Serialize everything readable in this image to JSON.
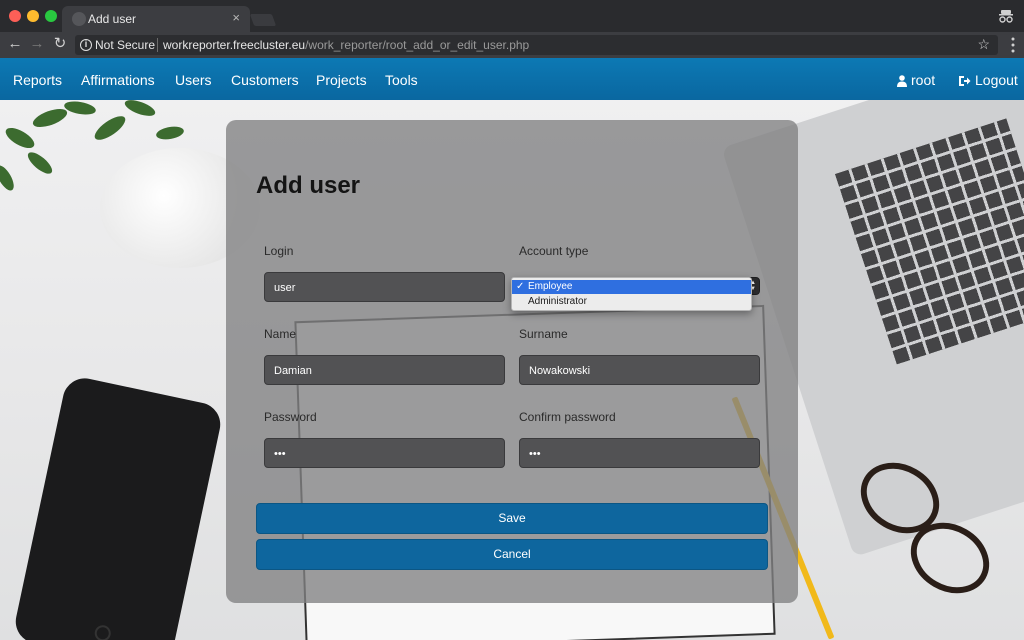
{
  "browser": {
    "tab_title": "Add user",
    "tab_close": "×",
    "security_label": "Not Secure",
    "url_host": "workreporter.freecluster.eu",
    "url_path": "/work_reporter/root_add_or_edit_user.php"
  },
  "navbar": {
    "items": [
      "Reports",
      "Affirmations",
      "Users",
      "Customers",
      "Projects",
      "Tools"
    ],
    "user_label": "root",
    "logout_label": "Logout"
  },
  "form": {
    "title": "Add user",
    "login_label": "Login",
    "login_value": "user",
    "account_type_label": "Account type",
    "account_type_options": [
      "Employee",
      "Administrator"
    ],
    "account_type_selected": "Employee",
    "name_label": "Name",
    "name_value": "Damian",
    "surname_label": "Surname",
    "surname_value": "Nowakowski",
    "password_label": "Password",
    "password_value": "•••",
    "confirm_password_label": "Confirm password",
    "confirm_password_value": "•••",
    "save_label": "Save",
    "cancel_label": "Cancel"
  },
  "colors": {
    "navbar": "#0c79b4",
    "button": "#0e669e",
    "card": "#808082"
  }
}
